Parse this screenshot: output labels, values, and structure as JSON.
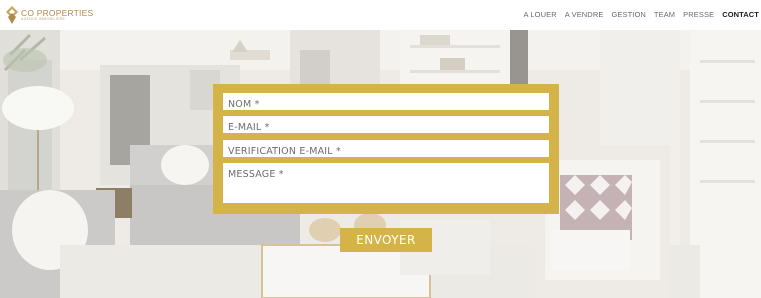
{
  "brand": {
    "name": "CO PROPERTIES",
    "tagline": "AGENCE IMMOBILIERE",
    "accent": "#d4b448",
    "logo_color": "#b08a4a"
  },
  "nav": {
    "items": [
      "A LOUER",
      "A VENDRE",
      "GESTION",
      "TEAM",
      "PRESSE",
      "CONTACT"
    ],
    "active": "CONTACT"
  },
  "form": {
    "fields": [
      {
        "label": "NOM *"
      },
      {
        "label": "E-MAIL *"
      },
      {
        "label": "VERIFICATION E-MAIL  *"
      },
      {
        "label": "MESSAGE *"
      }
    ],
    "submit": "ENVOYER"
  }
}
